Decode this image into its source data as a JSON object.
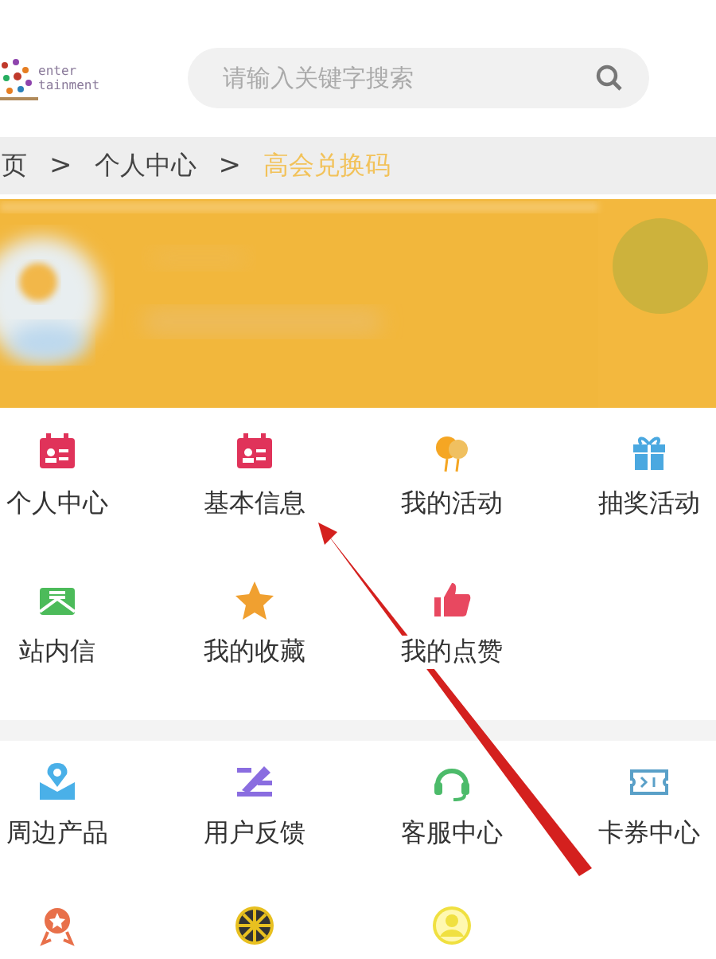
{
  "logo": {
    "lines": [
      "enter",
      "tainment"
    ]
  },
  "search": {
    "placeholder": "请输入关键字搜索"
  },
  "breadcrumb": [
    {
      "label": "页",
      "current": false
    },
    {
      "label": "个人中心",
      "current": false
    },
    {
      "label": "高会兑换码",
      "current": true
    }
  ],
  "breadcrumb_separator": ">",
  "sections": [
    {
      "items": [
        {
          "kind": "labeled",
          "label": "个人中心"
        },
        {
          "kind": "labeled",
          "label": "基本信息"
        },
        {
          "kind": "labeled",
          "label": "我的活动"
        },
        {
          "kind": "labeled",
          "label": "抽奖活动"
        },
        {
          "kind": "labeled",
          "label": "站内信"
        },
        {
          "kind": "labeled",
          "label": "我的收藏"
        },
        {
          "kind": "labeled",
          "label": "我的点赞"
        }
      ]
    },
    {
      "items": [
        {
          "kind": "labeled",
          "label": "周边产品"
        },
        {
          "kind": "labeled",
          "label": "用户反馈"
        },
        {
          "kind": "labeled",
          "label": "客服中心"
        },
        {
          "kind": "labeled",
          "label": "卡券中心"
        },
        {
          "kind": "icon-only"
        },
        {
          "kind": "icon-only"
        },
        {
          "kind": "icon-only"
        }
      ]
    }
  ],
  "annotation": {
    "kind": "arrow"
  }
}
